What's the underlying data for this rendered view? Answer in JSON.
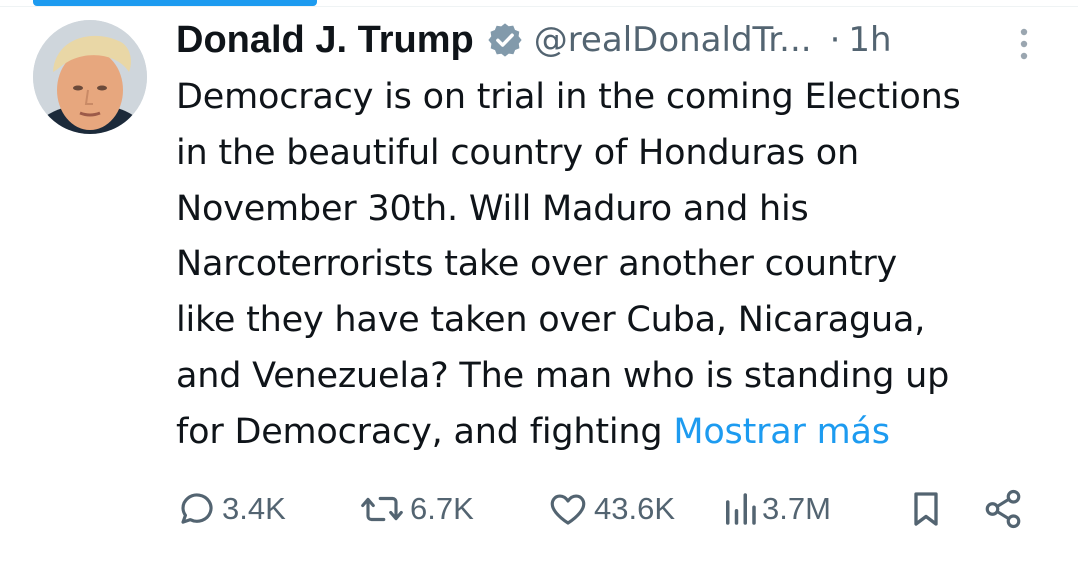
{
  "author": {
    "display_name": "Donald J. Trump",
    "handle": "@realDonaldTr...",
    "verified_icon": "verified-badge-icon"
  },
  "meta": {
    "separator": "·",
    "time_ago": "1h",
    "more_icon": "more-vertical-icon"
  },
  "tweet": {
    "lines": [
      "Democracy is on trial in the coming Elections",
      "in the beautiful country of Honduras on",
      "November 30th. Will Maduro and his",
      "Narcoterrorists take over another country",
      "like they have taken over Cuba, Nicaragua,",
      "and Venezuela? The man who is standing up",
      "for Democracy, and fighting "
    ],
    "show_more": "Mostrar más"
  },
  "actions": {
    "replies": "3.4K",
    "reposts": "6.7K",
    "likes": "43.6K",
    "views": "3.7M",
    "bookmark_icon": "bookmark-icon",
    "share_icon": "share-icon"
  },
  "colors": {
    "accent": "#1d9bf0",
    "text": "#0f1419",
    "muted": "#536471"
  }
}
